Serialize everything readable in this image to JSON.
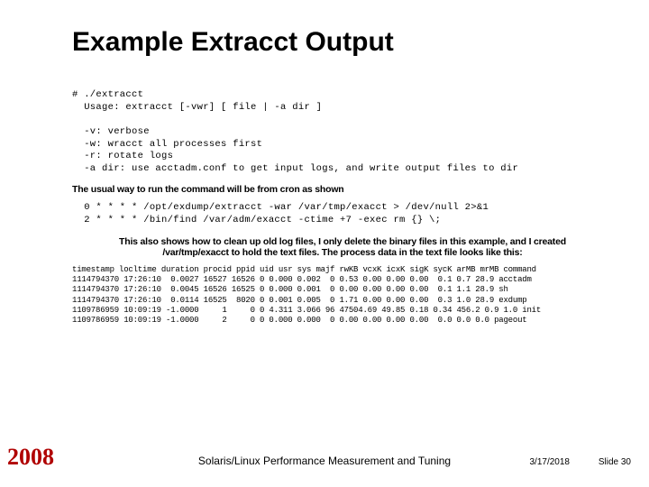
{
  "title": "Example Extracct Output",
  "code1": "# ./extracct\n  Usage: extracct [-vwr] [ file | -a dir ]\n\n  -v: verbose\n  -w: wracct all processes first\n  -r: rotate logs\n  -a dir: use acctadm.conf to get input logs, and write output files to dir",
  "desc1": "The usual way to run the command will be from cron as shown",
  "code2": "  0 * * * * /opt/exdump/extracct -war /var/tmp/exacct > /dev/null 2>&1\n  2 * * * * /bin/find /var/adm/exacct -ctime +7 -exec rm {} \\;",
  "desc2": "This also shows how to clean up old log files, I only delete the binary files in this example, and I created /var/tmp/exacct to hold the text files. The process data in the text file looks like this:",
  "table": "timestamp locltime duration procid ppid uid usr sys majf rwKB vcxK icxK sigK sycK arMB mrMB command\n1114794370 17:26:10  0.0027 16527 16526 0 0.000 0.002  0 0.53 0.00 0.00 0.00  0.1 0.7 28.9 acctadm\n1114794370 17:26:10  0.0045 16526 16525 0 0.000 0.001  0 0.00 0.00 0.00 0.00  0.1 1.1 28.9 sh\n1114794370 17:26:10  0.0114 16525  8020 0 0.001 0.005  0 1.71 0.00 0.00 0.00  0.3 1.0 28.9 exdump\n1109786959 10:09:19 -1.0000     1     0 0 4.311 3.066 96 47504.69 49.85 0.18 0.34 456.2 0.9 1.0 init\n1109786959 10:09:19 -1.0000     2     0 0 0.000 0.000  0 0.00 0.00 0.00 0.00  0.0 0.0 0.0 pageout",
  "footer": {
    "year": "2008",
    "center": "Solaris/Linux Performance Measurement and Tuning",
    "date": "3/17/2018",
    "slide": "Slide 30"
  }
}
